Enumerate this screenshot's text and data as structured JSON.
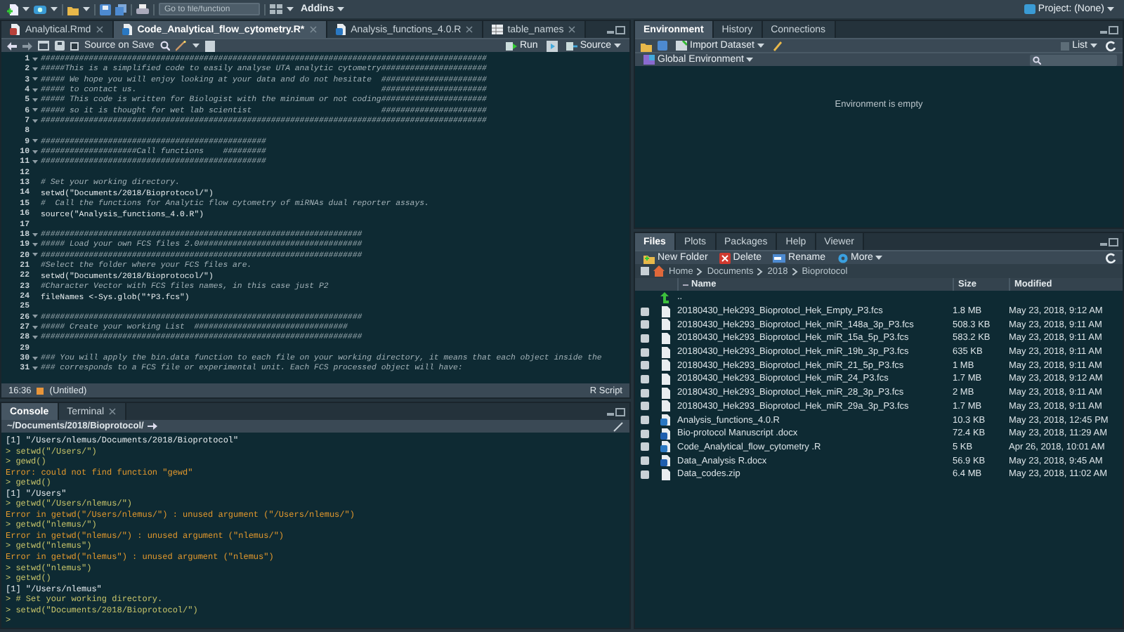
{
  "toolbar": {
    "search": {
      "placeholder": "Go to file/function"
    },
    "addins": "Addins",
    "project": "Project: (None)"
  },
  "editor": {
    "tabs": [
      {
        "label": "Analytical.Rmd",
        "kind": "rmd",
        "selected": false
      },
      {
        "label": "Code_Analytical_flow_cytometry.R*",
        "kind": "r",
        "selected": true
      },
      {
        "label": "Analysis_functions_4.0.R",
        "kind": "r",
        "selected": false
      },
      {
        "label": "table_names",
        "kind": "table",
        "selected": false
      }
    ],
    "source_on_save": {
      "label": "Source on Save",
      "checked": false
    },
    "run": "Run",
    "source": "Source",
    "lines": [
      {
        "number": "1",
        "kind": "comment",
        "fold": true,
        "text": "#############################################################################################"
      },
      {
        "number": "2",
        "kind": "comment",
        "fold": true,
        "text": "#####This is a simplified code to easily analyse UTA analytic cytometry######################"
      },
      {
        "number": "3",
        "kind": "comment",
        "fold": true,
        "text": "##### We hope you will enjoy looking at your data and do not hesitate  ######################"
      },
      {
        "number": "4",
        "kind": "comment",
        "fold": true,
        "text": "##### to contact us.                                                   ######################"
      },
      {
        "number": "5",
        "kind": "comment",
        "fold": true,
        "text": "##### This code is written for Biologist with the minimum or not coding######################"
      },
      {
        "number": "6",
        "kind": "comment",
        "fold": true,
        "text": "##### so it is thought for wet lab scientist                           ######################"
      },
      {
        "number": "7",
        "kind": "comment",
        "fold": true,
        "text": "#############################################################################################"
      },
      {
        "number": "8",
        "kind": "blank",
        "fold": false
      },
      {
        "number": "9",
        "kind": "comment",
        "fold": true,
        "text": "###############################################"
      },
      {
        "number": "10",
        "kind": "comment",
        "fold": true,
        "text": "####################Call functions    #########"
      },
      {
        "number": "11",
        "kind": "comment",
        "fold": true,
        "text": "###############################################"
      },
      {
        "number": "12",
        "kind": "blank",
        "fold": false
      },
      {
        "number": "13",
        "kind": "comment",
        "fold": false,
        "text": "# Set your working directory."
      },
      {
        "number": "14",
        "kind": "code",
        "fold": false,
        "text": "setwd(\"Documents/2018/Bioprotocol/\")"
      },
      {
        "number": "15",
        "kind": "comment",
        "fold": false,
        "text": "#  Call the functions for Analytic flow cytometry of miRNAs dual reporter assays."
      },
      {
        "number": "16",
        "kind": "code",
        "fold": false,
        "text": "source(\"Analysis_functions_4.0.R\")"
      },
      {
        "number": "17",
        "kind": "blank",
        "fold": false
      },
      {
        "number": "18",
        "kind": "comment",
        "fold": true,
        "text": "###################################################################"
      },
      {
        "number": "19",
        "kind": "comment",
        "fold": true,
        "text": "##### Load your own FCS files 2.0##################################"
      },
      {
        "number": "20",
        "kind": "comment",
        "fold": true,
        "text": "###################################################################"
      },
      {
        "number": "21",
        "kind": "comment",
        "fold": false,
        "text": "#Select the folder where your FCS files are."
      },
      {
        "number": "22",
        "kind": "code",
        "fold": false,
        "text": "setwd(\"Documents/2018/Bioprotocol/\")"
      },
      {
        "number": "23",
        "kind": "comment",
        "fold": false,
        "text": "#Character Vector with FCS files names, in this case just P2"
      },
      {
        "number": "24",
        "kind": "code",
        "fold": false,
        "text": "fileNames <-Sys.glob(\"*P3.fcs\")"
      },
      {
        "number": "25",
        "kind": "blank",
        "fold": false
      },
      {
        "number": "26",
        "kind": "comment",
        "fold": true,
        "text": "###################################################################"
      },
      {
        "number": "27",
        "kind": "comment",
        "fold": true,
        "text": "##### Create your working List  ################################"
      },
      {
        "number": "28",
        "kind": "comment",
        "fold": true,
        "text": "###################################################################"
      },
      {
        "number": "29",
        "kind": "blank",
        "fold": false
      },
      {
        "number": "30",
        "kind": "comment",
        "fold": true,
        "text": "### You will apply the bin.data function to each file on your working directory, it means that each object inside the"
      },
      {
        "number": "31",
        "kind": "comment",
        "fold": true,
        "text": "### corresponds to a FCS file or experimental unit. Each FCS processed object will have:"
      }
    ],
    "status": {
      "position": "16:36",
      "scope": "(Untitled)",
      "file_type": "R Script"
    }
  },
  "console": {
    "tabs": [
      {
        "label": "Console",
        "selected": true
      },
      {
        "label": "Terminal",
        "selected": false
      }
    ],
    "path": "~/Documents/2018/Bioprotocol/",
    "lines": [
      {
        "kind": "output",
        "text": "[1] \"/Users/nlemus/Documents/2018/Bioprotocol\""
      },
      {
        "kind": "input",
        "text": "> setwd(\"/Users/\")"
      },
      {
        "kind": "input",
        "text": "> gewd()"
      },
      {
        "kind": "error",
        "text": "Error: could not find function \"gewd\""
      },
      {
        "kind": "input",
        "text": "> getwd()"
      },
      {
        "kind": "output",
        "text": "[1] \"/Users\""
      },
      {
        "kind": "input",
        "text": "> getwd(\"/Users/nlemus/\")"
      },
      {
        "kind": "error",
        "text": "Error in getwd(\"/Users/nlemus/\") : unused argument (\"/Users/nlemus/\")"
      },
      {
        "kind": "input",
        "text": "> getwd(\"nlemus/\")"
      },
      {
        "kind": "error",
        "text": "Error in getwd(\"nlemus/\") : unused argument (\"nlemus/\")"
      },
      {
        "kind": "input",
        "text": "> getwd(\"nlemus\")"
      },
      {
        "kind": "error",
        "text": "Error in getwd(\"nlemus\") : unused argument (\"nlemus\")"
      },
      {
        "kind": "input",
        "text": "> setwd(\"nlemus\")"
      },
      {
        "kind": "input",
        "text": "> getwd()"
      },
      {
        "kind": "output",
        "text": "[1] \"/Users/nlemus\""
      },
      {
        "kind": "input",
        "text": "> # Set your working directory."
      },
      {
        "kind": "input",
        "text": "> setwd(\"Documents/2018/Bioprotocol/\")"
      },
      {
        "kind": "input",
        "text": ">"
      }
    ]
  },
  "environment": {
    "tabs": [
      {
        "label": "Environment",
        "selected": true
      },
      {
        "label": "History",
        "selected": false
      },
      {
        "label": "Connections",
        "selected": false
      }
    ],
    "import": "Import Dataset",
    "view": "List",
    "scope": "Global Environment",
    "empty_message": "Environment is empty"
  },
  "files": {
    "tabs": [
      {
        "label": "Files",
        "selected": true
      },
      {
        "label": "Plots",
        "selected": false
      },
      {
        "label": "Packages",
        "selected": false
      },
      {
        "label": "Help",
        "selected": false
      },
      {
        "label": "Viewer",
        "selected": false
      }
    ],
    "actions": [
      "New Folder",
      "Delete",
      "Rename",
      "More"
    ],
    "breadcrumb": [
      "Home",
      "Documents",
      "2018",
      "Bioprotocol"
    ],
    "columns": [
      "Name",
      "Size",
      "Modified"
    ],
    "rows": [
      {
        "kind": "up",
        "name": ".."
      },
      {
        "kind": "plain",
        "checked": false,
        "name": "20180430_Hek293_Bioprotocl_Hek_Empty_P3.fcs",
        "size": "1.8 MB",
        "modified": "May 23, 2018, 9:12 AM"
      },
      {
        "kind": "plain",
        "checked": false,
        "name": "20180430_Hek293_Bioprotocl_Hek_miR_148a_3p_P3.fcs",
        "size": "508.3 KB",
        "modified": "May 23, 2018, 9:11 AM"
      },
      {
        "kind": "plain",
        "checked": false,
        "name": "20180430_Hek293_Bioprotocl_Hek_miR_15a_5p_P3.fcs",
        "size": "583.2 KB",
        "modified": "May 23, 2018, 9:11 AM"
      },
      {
        "kind": "plain",
        "checked": false,
        "name": "20180430_Hek293_Bioprotocl_Hek_miR_19b_3p_P3.fcs",
        "size": "635 KB",
        "modified": "May 23, 2018, 9:11 AM"
      },
      {
        "kind": "plain",
        "checked": false,
        "name": "20180430_Hek293_Bioprotocl_Hek_miR_21_5p_P3.fcs",
        "size": "1 MB",
        "modified": "May 23, 2018, 9:11 AM"
      },
      {
        "kind": "plain",
        "checked": false,
        "name": "20180430_Hek293_Bioprotocl_Hek_miR_24_P3.fcs",
        "size": "1.7 MB",
        "modified": "May 23, 2018, 9:12 AM"
      },
      {
        "kind": "plain",
        "checked": false,
        "name": "20180430_Hek293_Bioprotocl_Hek_miR_28_3p_P3.fcs",
        "size": "2 MB",
        "modified": "May 23, 2018, 9:11 AM"
      },
      {
        "kind": "plain",
        "checked": false,
        "name": "20180430_Hek293_Bioprotocl_Hek_miR_29a_3p_P3.fcs",
        "size": "1.7 MB",
        "modified": "May 23, 2018, 9:11 AM"
      },
      {
        "kind": "r",
        "checked": false,
        "name": "Analysis_functions_4.0.R",
        "size": "10.3 KB",
        "modified": "May 23, 2018, 12:45 PM"
      },
      {
        "kind": "word",
        "checked": false,
        "name": "Bio-protocol Manuscript .docx",
        "size": "72.4 KB",
        "modified": "May 23, 2018, 11:29 AM"
      },
      {
        "kind": "r",
        "checked": false,
        "name": "Code_Analytical_flow_cytometry .R",
        "size": "5 KB",
        "modified": "Apr 26, 2018, 10:01 AM"
      },
      {
        "kind": "word",
        "checked": false,
        "name": "Data_Analysis R.docx",
        "size": "56.9 KB",
        "modified": "May 23, 2018, 9:45 AM"
      },
      {
        "kind": "plain",
        "checked": false,
        "name": "Data_codes.zip",
        "size": "6.4 MB",
        "modified": "May 23, 2018, 11:02 AM"
      }
    ]
  }
}
